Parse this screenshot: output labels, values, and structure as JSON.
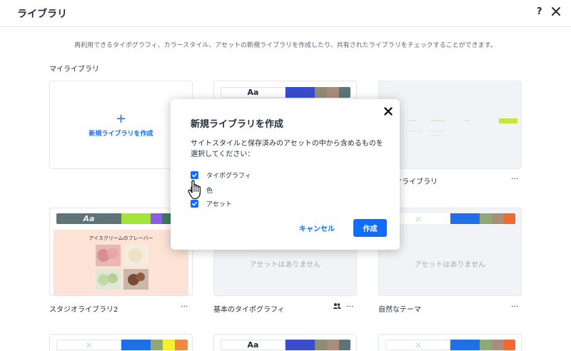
{
  "header": {
    "title": "ライブラリ",
    "help_label": "?"
  },
  "description": "再利用できるタイポグラフィ、カラースタイル、アセットの新規ライブラリを作成したり、共有されたライブラリをチェックすることができます。",
  "section_label": "マイライブラリ",
  "new_library": {
    "plus": "+",
    "label": "新規ライブラリを作成"
  },
  "cards": {
    "c2": {
      "aa": "Aa",
      "colors": [
        "#3a4ccd",
        "#8e8b78",
        "#a88c7c",
        "#5f7478"
      ]
    },
    "c3": {
      "caption": "オライブラリ",
      "more": "···",
      "mini_badge": "Try it for free"
    },
    "studio": {
      "aa": "Aa",
      "colors": [
        "#a3e33a",
        "#8a5ce8",
        "#3c7a5a"
      ],
      "preview_title": "アイスクリームのフレーバー",
      "caption": "スタジオライブラリ2",
      "more": "···"
    },
    "basic": {
      "empty": "アセットはありません",
      "caption": "基本のタイポグラフィ",
      "more": "···"
    },
    "natural": {
      "colors": [
        "#1f6fe8",
        "#8ea878",
        "#a88c7c",
        "#ee6a30"
      ],
      "empty": "アセットはありません",
      "caption": "自然なテーマ",
      "more": "···"
    },
    "b1": {
      "colors": [
        "#1f6fe8",
        "#8ea878",
        "#f5ef30",
        "#ee8a40"
      ]
    },
    "b2": {
      "aa": "Aa",
      "colors": [
        "#3a4ccd",
        "#8e8b78",
        "#a88c7c",
        "#5f7478"
      ]
    },
    "b3": {
      "colors": [
        "#1f6fe8",
        "#8ea878",
        "#a88c7c",
        "#ee6a30"
      ]
    }
  },
  "dialog": {
    "title": "新規ライブラリを作成",
    "description": "サイトスタイルと保存済みのアセットの中から含めるものを選択してください：",
    "options": [
      {
        "label": "タイポグラフィ",
        "checked": true
      },
      {
        "label": "色",
        "checked": true
      },
      {
        "label": "アセット",
        "checked": true
      }
    ],
    "cancel_label": "キャンセル",
    "create_label": "作成"
  },
  "colors": {
    "accent": "#116dff",
    "text": "#20303c",
    "muted": "#a3abb5"
  }
}
